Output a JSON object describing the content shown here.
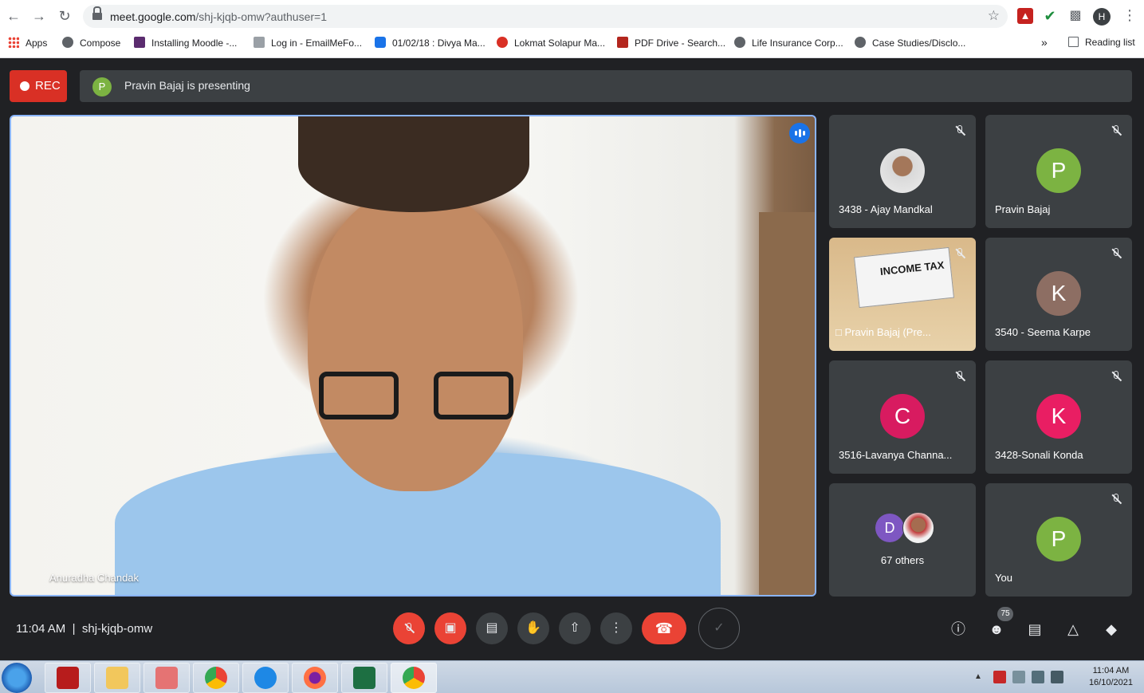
{
  "browser": {
    "url_host": "meet.google.com",
    "url_path": "/shj-kjqb-omw?authuser=1",
    "profile_initial": "H"
  },
  "bookmarks": [
    "Apps",
    "Compose",
    "Installing Moodle -...",
    "Log in - EmailMeFo...",
    "01/02/18 : Divya Ma...",
    "Lokmat Solapur Ma...",
    "PDF Drive - Search...",
    "Life Insurance Corp...",
    "Case Studies/Disclo..."
  ],
  "reading_list": "Reading list",
  "meet": {
    "rec_label": "REC",
    "presenter_initial": "P",
    "presenting_text": "Pravin Bajaj is presenting",
    "main_speaker": "Anuradha Chandak",
    "tiles": {
      "t1": {
        "name": "3438 - Ajay Mandkal"
      },
      "t2": {
        "initial": "P",
        "name": "Pravin Bajaj"
      },
      "t3": {
        "name": "Pravin Bajaj (Pre...",
        "slide_text": "INCOME TAX"
      },
      "t4": {
        "initial": "K",
        "name": "3540 - Seema Karpe"
      },
      "t5": {
        "initial": "C",
        "name": "3516-Lavanya Channa..."
      },
      "t6": {
        "initial": "K",
        "name": "3428-Sonali Konda"
      },
      "t7": {
        "initial": "D",
        "name": "67 others"
      },
      "t8": {
        "initial": "P",
        "name": "You"
      }
    },
    "time": "11:04 AM",
    "separator": "|",
    "meeting_code": "shj-kjqb-omw",
    "participant_count": "75"
  },
  "taskbar": {
    "time": "11:04 AM",
    "date": "16/10/2021"
  },
  "colors": {
    "red": "#ea4335",
    "green_avatar": "#7cb342",
    "brown_avatar": "#8d6e63",
    "pink_avatar": "#d81b60",
    "magenta_avatar": "#e91e63",
    "blue_highlight": "#8ab4f8"
  }
}
